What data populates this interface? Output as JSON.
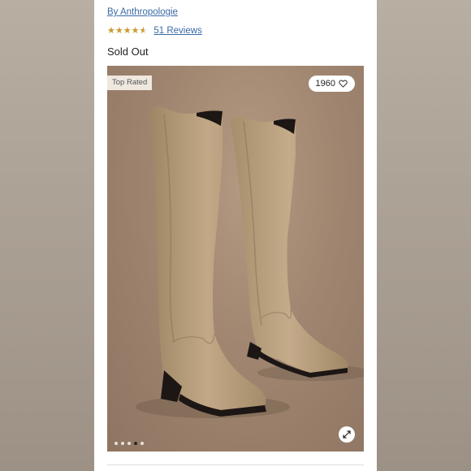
{
  "product": {
    "brand_link": "By Anthropologie",
    "rating": 4.5,
    "reviews_link": "51 Reviews",
    "status": "Sold Out"
  },
  "gallery": {
    "badge": "Top Rated",
    "favorites_count": "1960",
    "total_images": 5,
    "active_image_index": 4
  },
  "colors": {
    "link": "#3a6aa6",
    "star": "#c79a2a",
    "badge_bg": "#efe8df"
  },
  "icons": [
    "heart-icon",
    "expand-icon",
    "star-icon"
  ]
}
